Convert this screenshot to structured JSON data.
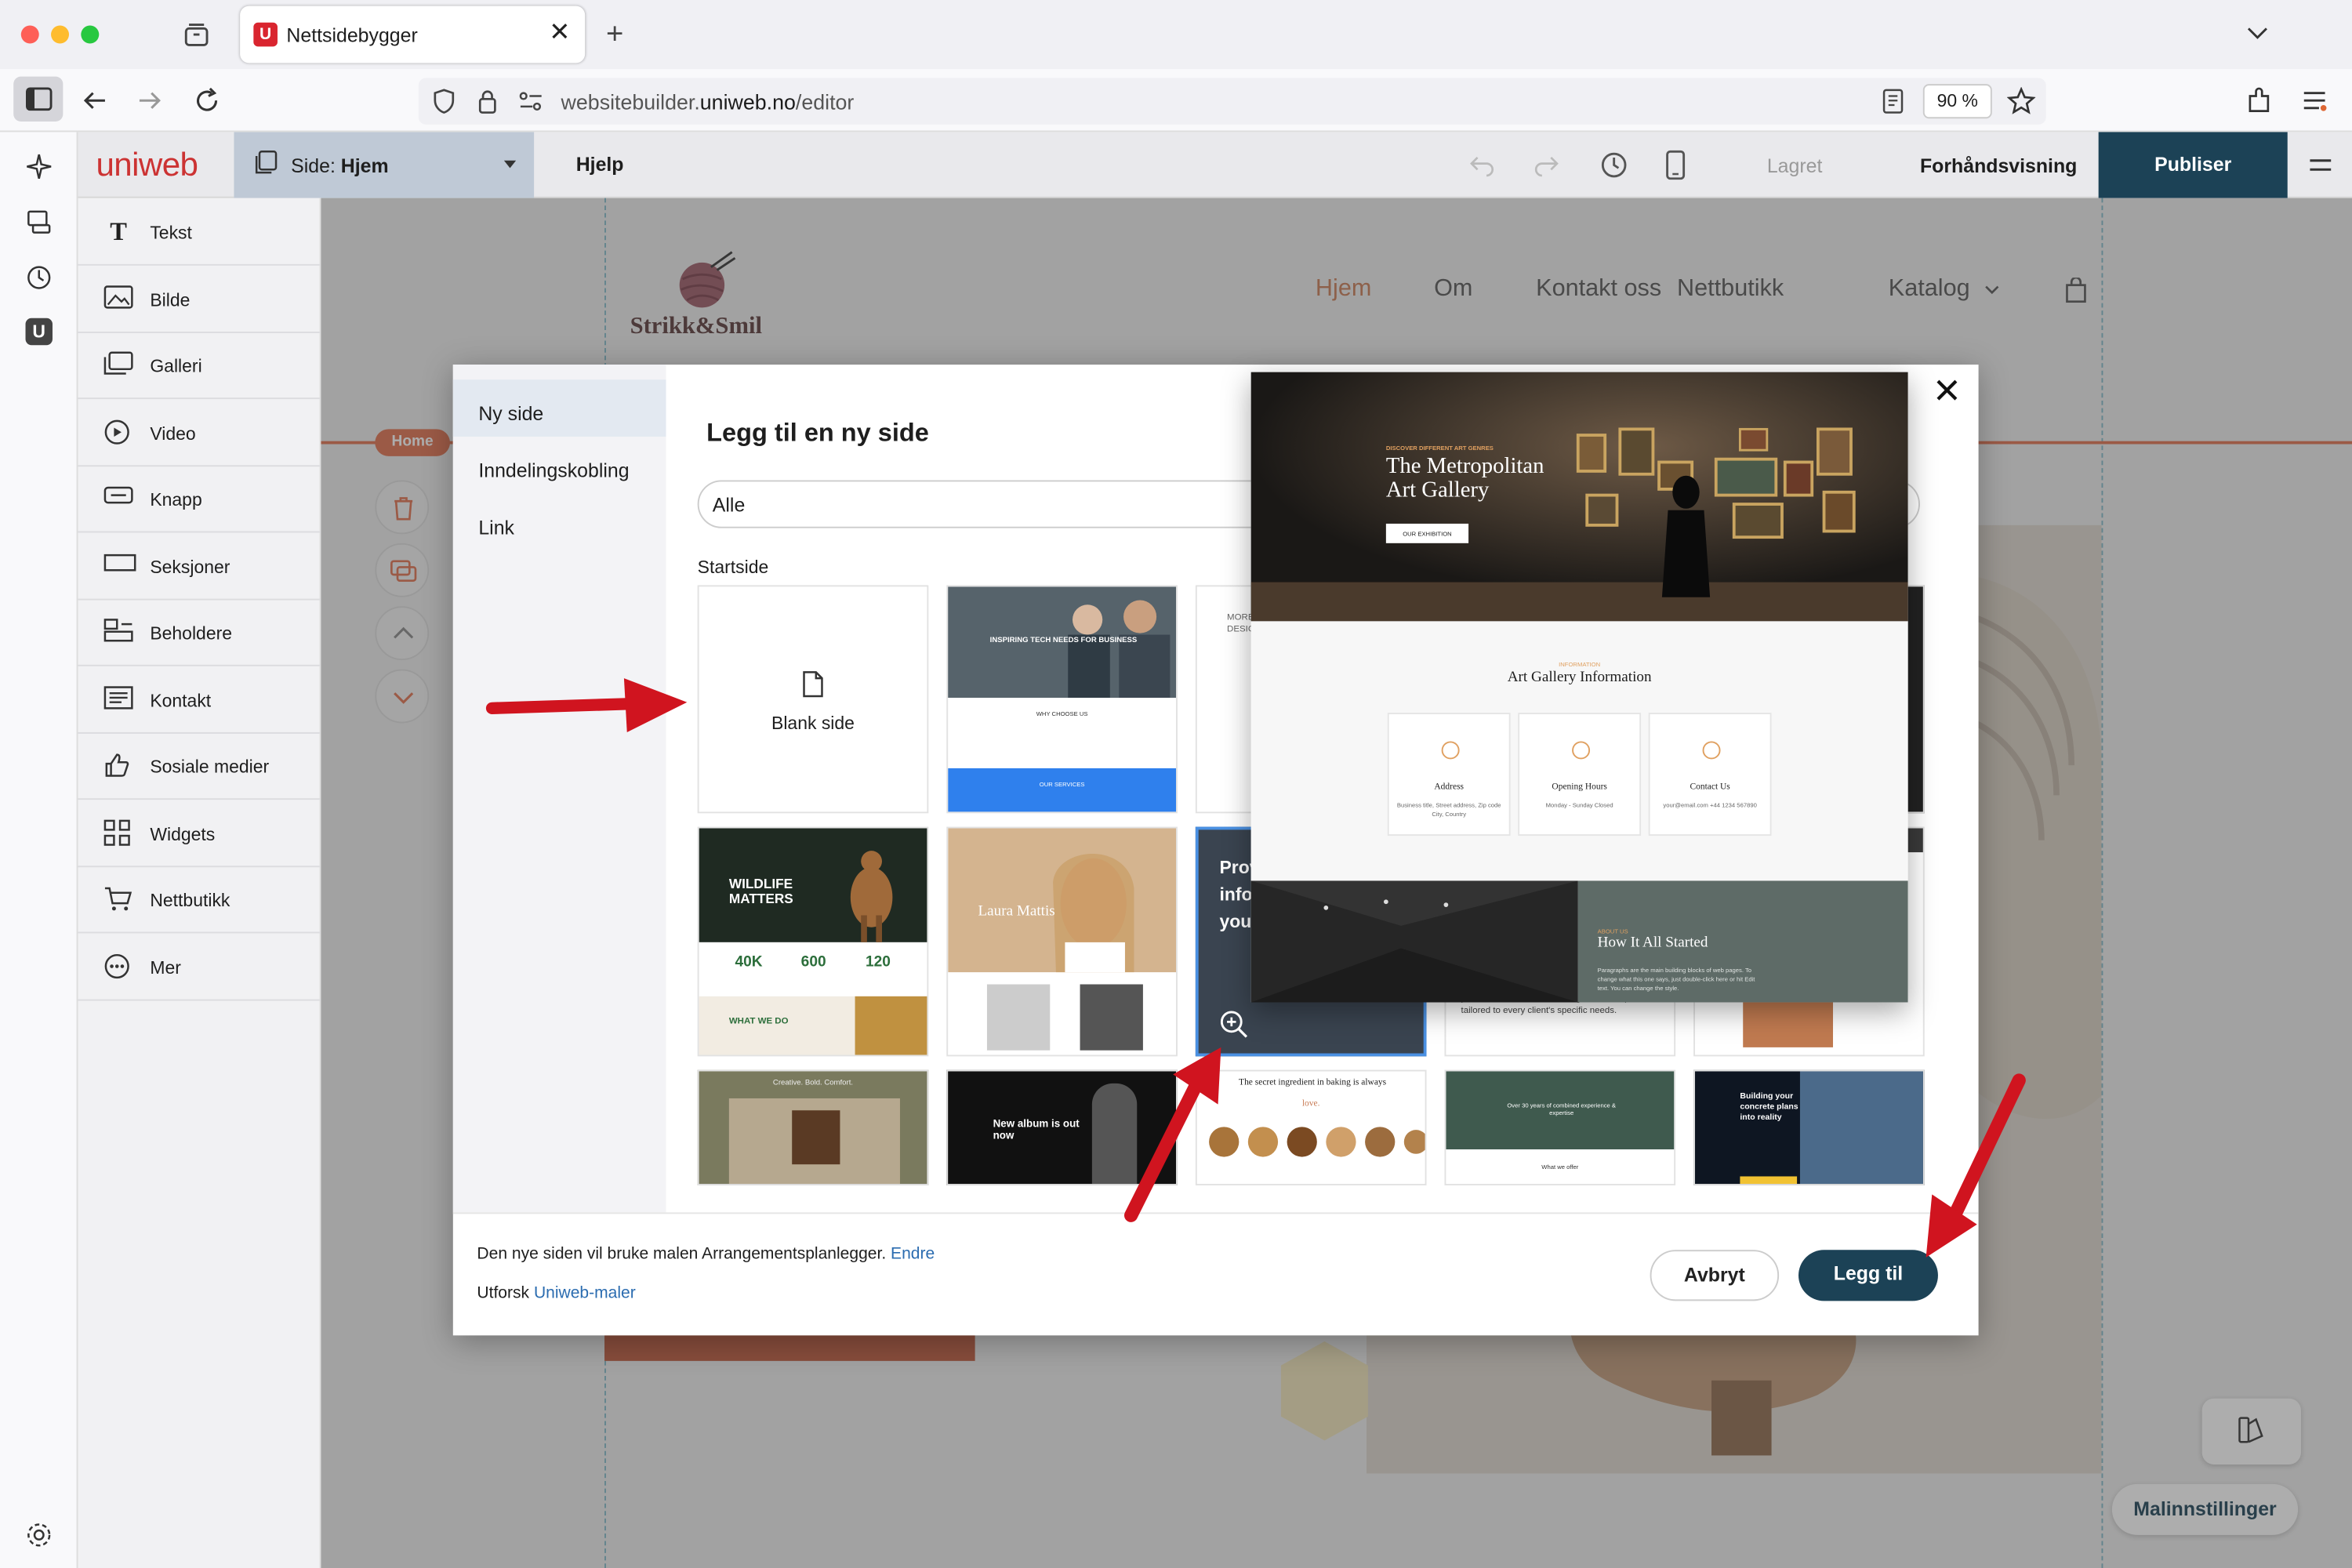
{
  "browser": {
    "tab_title": "Nettsidebygger",
    "url_prefix": "websitebuilder.",
    "url_host": "uniweb.no",
    "url_path": "/editor",
    "zoom": "90 %"
  },
  "app": {
    "logo": "uniweb",
    "page_select_label": "Side: ",
    "page_select_value": "Hjem",
    "help": "Hjelp",
    "saved": "Lagret",
    "preview": "Forhåndsvisning",
    "publish": "Publiser"
  },
  "elements": [
    {
      "label": "Tekst",
      "icon": "text-icon"
    },
    {
      "label": "Bilde",
      "icon": "image-icon"
    },
    {
      "label": "Galleri",
      "icon": "gallery-icon"
    },
    {
      "label": "Video",
      "icon": "video-icon"
    },
    {
      "label": "Knapp",
      "icon": "button-icon"
    },
    {
      "label": "Seksjoner",
      "icon": "sections-icon"
    },
    {
      "label": "Beholdere",
      "icon": "containers-icon"
    },
    {
      "label": "Kontakt",
      "icon": "contact-icon"
    },
    {
      "label": "Sosiale medier",
      "icon": "social-icon"
    },
    {
      "label": "Widgets",
      "icon": "widgets-icon"
    },
    {
      "label": "Nettbutikk",
      "icon": "cart-icon"
    },
    {
      "label": "Mer",
      "icon": "more-icon"
    }
  ],
  "site": {
    "brand": "Strikk&Smil",
    "nav": [
      "Hjem",
      "Om",
      "Kontakt oss",
      "Nettbutikk",
      "Katalog"
    ],
    "home_tag": "Home"
  },
  "dialog": {
    "side_items": [
      "Ny side",
      "Inndelingskobling",
      "Link"
    ],
    "title": "Legg til en ny side",
    "filter_value": "Alle",
    "section_label": "Startside",
    "blank_label": "Blank side",
    "footer_text": "Den nye siden vil bruke malen Arrangementsplanlegger.",
    "footer_link": "Endre",
    "explore_text": "Utforsk ",
    "explore_link": "Uniweb-maler",
    "cancel": "Avbryt",
    "add": "Legg til",
    "templates": {
      "t1_title": "INSPIRING TECH NEEDS FOR BUSINESS",
      "t1_sub": "WHY CHOOSE US",
      "t1_foot": "OUR SERVICES",
      "t2_a": "MORE",
      "t2_b": "DESIG",
      "t3_title": "WILDLIFE MATTERS",
      "t3_stats": [
        "40K",
        "600",
        "120"
      ],
      "t3_what": "WHAT WE DO",
      "t4_name": "Laura Mattis",
      "t5_text": [
        "Prov",
        "info",
        "you"
      ],
      "t6_text": "private wealth, our team designs custom portfolios tailored to every client's specific needs.",
      "t7_title": "Creative. Bold. Comfort.",
      "t8_title": "New album is out now",
      "t9_title": "The secret ingredient in baking is always",
      "t9_love": "love.",
      "t10_title": "Over 30 years of combined experience & expertise",
      "t10_sub": "What we offer",
      "t11_title": "Building your concrete plans into reality"
    },
    "preview": {
      "kicker": "DISCOVER DIFFERENT ART GENRES",
      "title_l1": "The Metropolitan",
      "title_l2": "Art Gallery",
      "button": "OUR EXHIBITION",
      "info_kicker": "INFORMATION",
      "info_title": "Art Gallery Information",
      "cards": [
        {
          "title": "Address",
          "text": "Business title, Street address, Zip code City, Country"
        },
        {
          "title": "Opening Hours",
          "text": "Monday - Sunday Closed"
        },
        {
          "title": "Contact Us",
          "text": "your@email.com +44 1234 567890"
        }
      ],
      "about_kicker": "ABOUT US",
      "about_title": "How It All Started",
      "about_text": "Paragraphs are the main building blocks of web pages. To change what this one says, just double-click here or hit Edit text. You can change the style."
    }
  },
  "floating": {
    "template_settings": "Malinnstillinger"
  },
  "colors": {
    "brand_red": "#cc3333",
    "publish_bg": "#1c4256",
    "link": "#2b6cb0",
    "annotation_arrow": "#d0141f",
    "active_nav": "#c87b55"
  }
}
